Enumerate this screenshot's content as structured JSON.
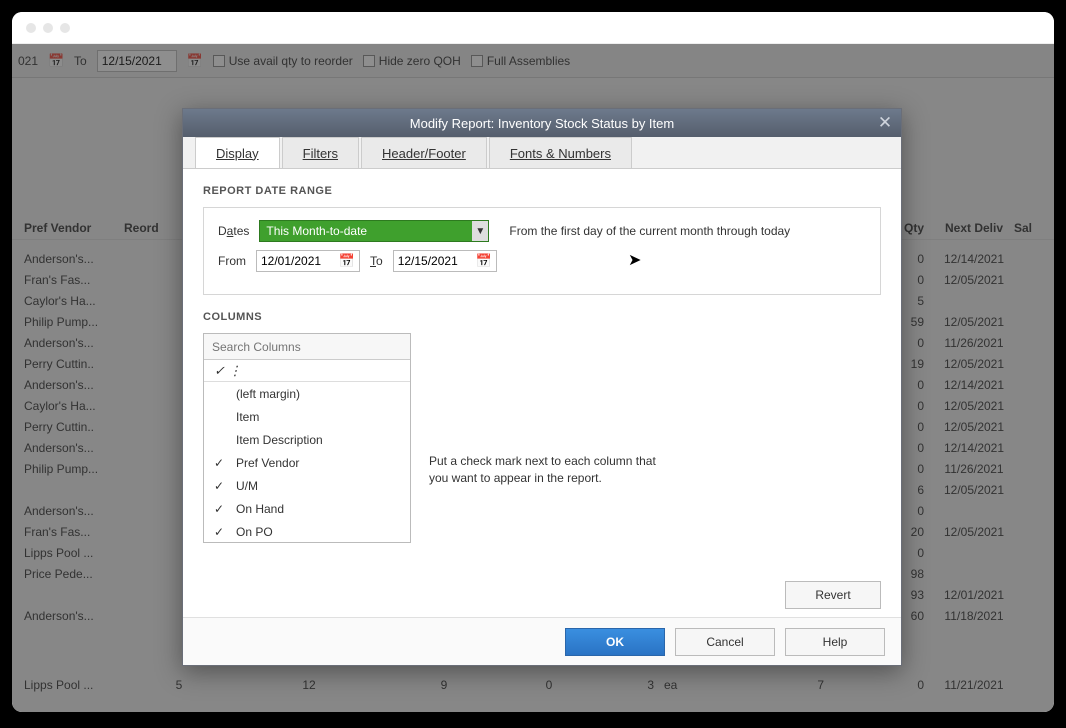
{
  "toolbar": {
    "date_fragment": "021",
    "to_label": "To",
    "to_date": "12/15/2021",
    "chk1": "Use avail qty to reorder",
    "chk2": "Hide zero QOH",
    "chk3": "Full Assemblies"
  },
  "headers": {
    "vendor": "Pref Vendor",
    "reord": "Reord",
    "qty": "Qty",
    "deliv": "Next Deliv",
    "sal": "Sal"
  },
  "rows": [
    {
      "vendor": "Anderson's...",
      "qty": "0",
      "deliv": "12/14/2021"
    },
    {
      "vendor": "Fran's Fas...",
      "qty": "0",
      "deliv": "12/05/2021"
    },
    {
      "vendor": "Caylor's Ha...",
      "qty": "5",
      "deliv": ""
    },
    {
      "vendor": "Philip Pump...",
      "qty": "59",
      "deliv": "12/05/2021"
    },
    {
      "vendor": "Anderson's...",
      "qty": "0",
      "deliv": "11/26/2021"
    },
    {
      "vendor": "Perry Cuttin..",
      "qty": "19",
      "deliv": "12/05/2021"
    },
    {
      "vendor": "Anderson's...",
      "qty": "0",
      "deliv": "12/14/2021"
    },
    {
      "vendor": "Caylor's Ha...",
      "qty": "0",
      "deliv": "12/05/2021"
    },
    {
      "vendor": "Perry Cuttin..",
      "qty": "0",
      "deliv": "12/05/2021"
    },
    {
      "vendor": "Anderson's...",
      "qty": "0",
      "deliv": "12/14/2021"
    },
    {
      "vendor": "Philip Pump...",
      "qty": "0",
      "deliv": "11/26/2021"
    },
    {
      "vendor": "",
      "qty": "6",
      "deliv": "12/05/2021"
    },
    {
      "vendor": "Anderson's...",
      "qty": "0",
      "deliv": ""
    },
    {
      "vendor": "Fran's Fas...",
      "qty": "20",
      "deliv": "12/05/2021"
    },
    {
      "vendor": "Lipps Pool ...",
      "qty": "0",
      "deliv": ""
    },
    {
      "vendor": "Price Pede...",
      "qty": "98",
      "deliv": ""
    },
    {
      "vendor": "",
      "qty": "93",
      "deliv": "12/01/2021"
    },
    {
      "vendor": "Anderson's...",
      "qty": "60",
      "deliv": "11/18/2021"
    }
  ],
  "extra_row": {
    "vendor": "Lipps Pool ...",
    "c1": "5",
    "c2": "12",
    "c3": "9",
    "c4": "0",
    "c5": "3",
    "uom": "ea",
    "c6": "7",
    "qty": "0",
    "deliv": "11/21/2021"
  },
  "modal": {
    "title": "Modify Report: Inventory Stock Status by Item",
    "tabs": {
      "display": "Display",
      "filters": "Filters",
      "header_footer": "Header/Footer",
      "fonts_numbers": "Fonts & Numbers"
    },
    "date_range_label": "REPORT DATE RANGE",
    "dates_label": "Dates",
    "dates_value": "This Month-to-date",
    "dates_hint": "From the first day of the current month through today",
    "from_label": "From",
    "from_value": "12/01/2021",
    "to_label": "To",
    "to_value": "12/15/2021",
    "columns_label": "COLUMNS",
    "search_placeholder": "Search Columns",
    "check_header": "✓  ⋮",
    "columns": [
      {
        "checked": false,
        "label": "(left margin)"
      },
      {
        "checked": false,
        "label": "Item"
      },
      {
        "checked": false,
        "label": "Item Description"
      },
      {
        "checked": true,
        "label": "Pref Vendor"
      },
      {
        "checked": true,
        "label": "U/M"
      },
      {
        "checked": true,
        "label": "On Hand"
      },
      {
        "checked": true,
        "label": "On PO"
      }
    ],
    "columns_hint": "Put a check mark next to each column that you want to appear in the report.",
    "revert": "Revert",
    "ok": "OK",
    "cancel": "Cancel",
    "help": "Help"
  }
}
